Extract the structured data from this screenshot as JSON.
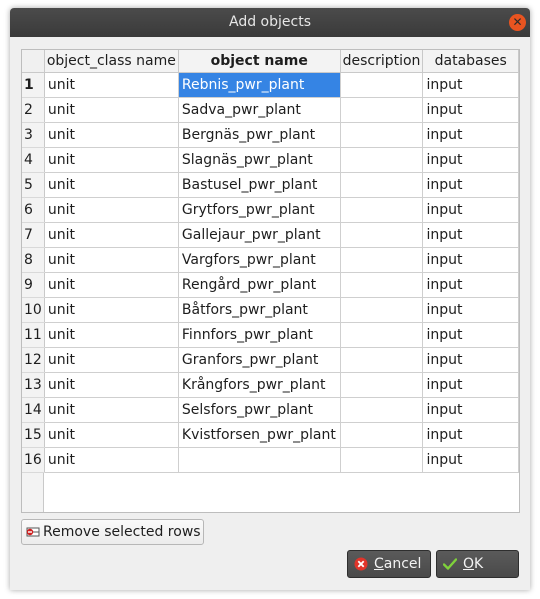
{
  "dialog": {
    "title": "Add objects"
  },
  "table": {
    "headers": {
      "object_class_name": "object_class name",
      "object_name": "object name",
      "description": "description",
      "databases": "databases"
    },
    "rows": [
      {
        "num": "1",
        "object_class": "unit",
        "object_name": "Rebnis_pwr_plant",
        "description": "",
        "database": "input"
      },
      {
        "num": "2",
        "object_class": "unit",
        "object_name": "Sadva_pwr_plant",
        "description": "",
        "database": "input"
      },
      {
        "num": "3",
        "object_class": "unit",
        "object_name": "Bergnäs_pwr_plant",
        "description": "",
        "database": "input"
      },
      {
        "num": "4",
        "object_class": "unit",
        "object_name": "Slagnäs_pwr_plant",
        "description": "",
        "database": "input"
      },
      {
        "num": "5",
        "object_class": "unit",
        "object_name": "Bastusel_pwr_plant",
        "description": "",
        "database": "input"
      },
      {
        "num": "6",
        "object_class": "unit",
        "object_name": "Grytfors_pwr_plant",
        "description": "",
        "database": "input"
      },
      {
        "num": "7",
        "object_class": "unit",
        "object_name": "Gallejaur_pwr_plant",
        "description": "",
        "database": "input"
      },
      {
        "num": "8",
        "object_class": "unit",
        "object_name": "Vargfors_pwr_plant",
        "description": "",
        "database": "input"
      },
      {
        "num": "9",
        "object_class": "unit",
        "object_name": "Rengård_pwr_plant",
        "description": "",
        "database": "input"
      },
      {
        "num": "10",
        "object_class": "unit",
        "object_name": "Båtfors_pwr_plant",
        "description": "",
        "database": "input"
      },
      {
        "num": "11",
        "object_class": "unit",
        "object_name": "Finnfors_pwr_plant",
        "description": "",
        "database": "input"
      },
      {
        "num": "12",
        "object_class": "unit",
        "object_name": "Granfors_pwr_plant",
        "description": "",
        "database": "input"
      },
      {
        "num": "13",
        "object_class": "unit",
        "object_name": "Krångfors_pwr_plant",
        "description": "",
        "database": "input"
      },
      {
        "num": "14",
        "object_class": "unit",
        "object_name": "Selsfors_pwr_plant",
        "description": "",
        "database": "input"
      },
      {
        "num": "15",
        "object_class": "unit",
        "object_name": "Kvistforsen_pwr_plant",
        "description": "",
        "database": "input"
      },
      {
        "num": "16",
        "object_class": "unit",
        "object_name": "",
        "description": "",
        "database": "input"
      }
    ]
  },
  "buttons": {
    "remove_rows_label": "Remove selected rows",
    "cancel_label_mnemonic": "C",
    "cancel_label_rest": "ancel",
    "ok_label_mnemonic": "O",
    "ok_label_rest": "K"
  },
  "icons": {
    "close": "close-icon",
    "remove_rows": "remove-rows-icon",
    "cancel": "cancel-icon",
    "ok": "ok-icon"
  },
  "colors": {
    "selection": "#3584e4",
    "close_button": "#e95420",
    "titlebar": "#3c3c3c"
  }
}
